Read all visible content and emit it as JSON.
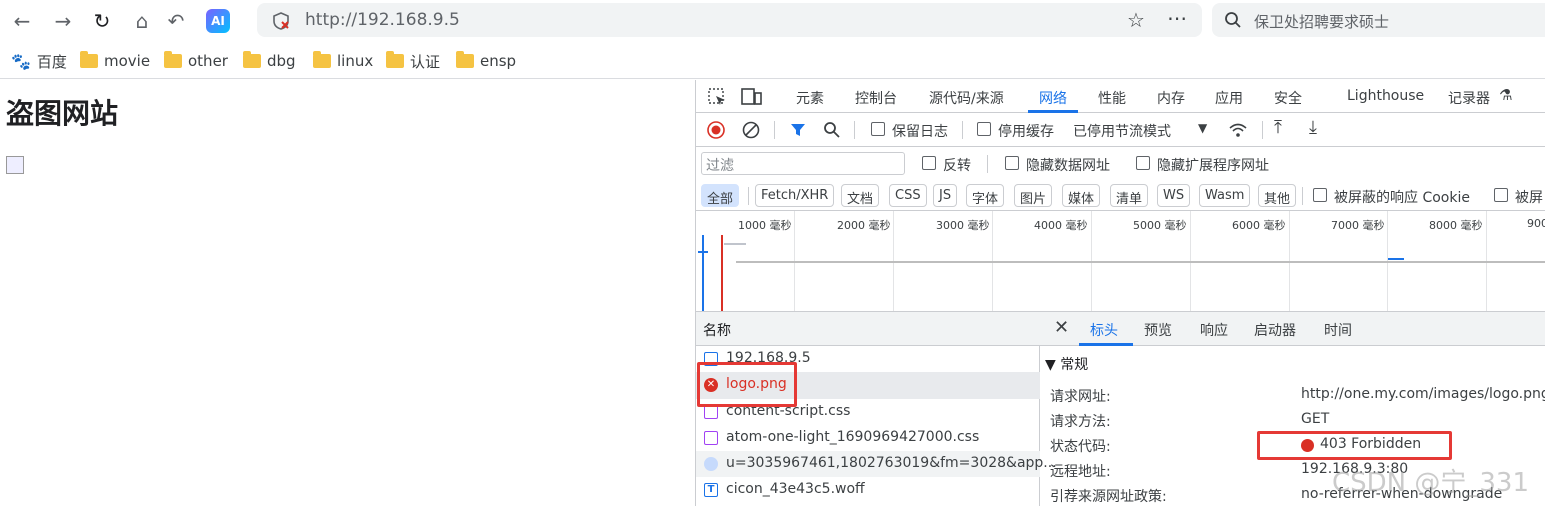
{
  "browser": {
    "url": "http://192.168.9.5",
    "search_placeholder": "保卫处招聘要求硕士",
    "ai_badge": "AI"
  },
  "bookmarks": [
    "百度",
    "movie",
    "other",
    "dbg",
    "linux",
    "认证",
    "ensp"
  ],
  "page": {
    "heading": "盗图网站"
  },
  "devtools": {
    "tabs": [
      "元素",
      "控制台",
      "源代码/来源",
      "网络",
      "性能",
      "内存",
      "应用",
      "安全",
      "Lighthouse",
      "记录器"
    ],
    "active_tab": "网络",
    "toolbar1": {
      "preserve_log": "保留日志",
      "disable_cache": "停用缓存",
      "throttle": "已停用节流模式"
    },
    "toolbar2": {
      "filter_placeholder": "过滤",
      "invert": "反转",
      "hide_data_urls": "隐藏数据网址",
      "hide_ext_urls": "隐藏扩展程序网址"
    },
    "type_filters": [
      "全部",
      "Fetch/XHR",
      "文档",
      "CSS",
      "JS",
      "字体",
      "图片",
      "媒体",
      "清单",
      "WS",
      "Wasm",
      "其他"
    ],
    "blocked_cookies": "被屏蔽的响应 Cookie",
    "blocked_trunc": "被屏",
    "timeline_ticks": [
      "1000 毫秒",
      "2000 毫秒",
      "3000 毫秒",
      "4000 毫秒",
      "5000 毫秒",
      "6000 毫秒",
      "7000 毫秒",
      "8000 毫秒",
      "900"
    ],
    "requests_header": "名称",
    "requests": [
      "192.168.9.5",
      "logo.png",
      "content-script.css",
      "atom-one-light_1690969427000.css",
      "u=3035967461,1802763019&fm=3028&app...",
      "cicon_43e43c5.woff"
    ],
    "detail_tabs": [
      "标头",
      "预览",
      "响应",
      "启动器",
      "时间"
    ],
    "section_title": "▼ 常规",
    "general": [
      {
        "key": "请求网址:",
        "value": "http://one.my.com/images/logo.png"
      },
      {
        "key": "请求方法:",
        "value": "GET"
      },
      {
        "key": "状态代码:",
        "value": "403 Forbidden"
      },
      {
        "key": "远程地址:",
        "value": "192.168.9.3:80"
      },
      {
        "key": "引荐来源网址政策:",
        "value": "no-referrer-when-downgrade"
      }
    ]
  },
  "watermark": "CSDN @宁_331",
  "colors": {
    "accent": "#1a73e8",
    "error": "#e53935",
    "highlight_box": "#e53935"
  }
}
